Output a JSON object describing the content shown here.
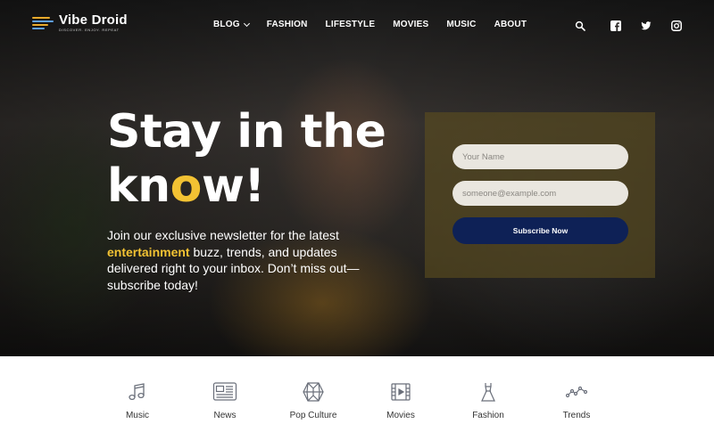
{
  "brand": {
    "name": "Vibe Droid",
    "tagline": "DISCOVER. ENJOY. REPEAT"
  },
  "nav": [
    {
      "label": "BLOG",
      "dropdown": true
    },
    {
      "label": "FASHION"
    },
    {
      "label": "LIFESTYLE"
    },
    {
      "label": "MOVIES"
    },
    {
      "label": "MUSIC"
    },
    {
      "label": "ABOUT"
    }
  ],
  "header_icons": [
    "search-icon",
    "facebook-icon",
    "twitter-icon",
    "instagram-icon"
  ],
  "hero": {
    "headline_line1": "Stay in the",
    "headline_kn": "kn",
    "headline_o": "o",
    "headline_w": "w!",
    "intro_before": "Join our exclusive newsletter for the latest ",
    "intro_highlight": "entertainment",
    "intro_after": " buzz, trends, and updates delivered right to your inbox. Don’t miss out—subscribe today!"
  },
  "form": {
    "name_placeholder": "Your Name",
    "email_placeholder": "someone@example.com",
    "submit_label": "Subscribe Now"
  },
  "categories": [
    {
      "label": "Music",
      "icon": "music-note-icon"
    },
    {
      "label": "News",
      "icon": "newspaper-icon"
    },
    {
      "label": "Pop Culture",
      "icon": "globe-icon"
    },
    {
      "label": "Movies",
      "icon": "film-icon"
    },
    {
      "label": "Fashion",
      "icon": "dress-icon"
    },
    {
      "label": "Trends",
      "icon": "trend-line-icon"
    }
  ],
  "colors": {
    "accent_yellow": "#f2c233",
    "button_navy": "#0e2156",
    "form_overlay": "#5c4e1e"
  }
}
